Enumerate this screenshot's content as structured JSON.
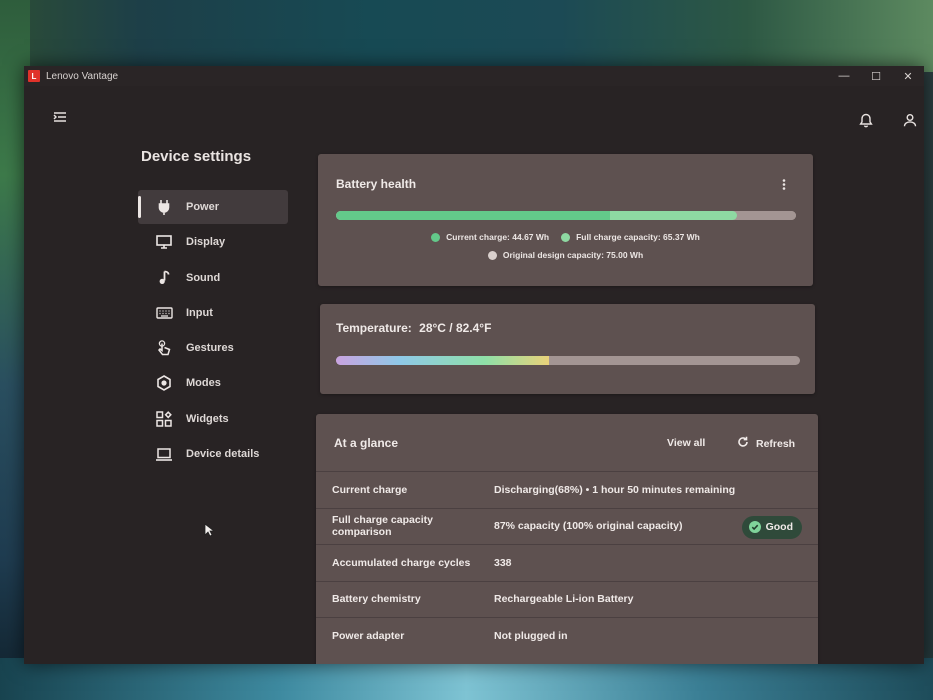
{
  "app": {
    "title": "Lenovo Vantage",
    "logo_letter": "L"
  },
  "window_controls": {
    "minimize": "—",
    "maximize": "☐",
    "close": "✕"
  },
  "page_title": "Device settings",
  "sidebar": {
    "items": [
      {
        "label": "Power",
        "icon": "power-plug-icon",
        "active": true
      },
      {
        "label": "Display",
        "icon": "monitor-icon",
        "active": false
      },
      {
        "label": "Sound",
        "icon": "music-note-icon",
        "active": false
      },
      {
        "label": "Input",
        "icon": "keyboard-icon",
        "active": false
      },
      {
        "label": "Gestures",
        "icon": "hand-gesture-icon",
        "active": false
      },
      {
        "label": "Modes",
        "icon": "hexagon-icon",
        "active": false
      },
      {
        "label": "Widgets",
        "icon": "widgets-icon",
        "active": false
      },
      {
        "label": "Device details",
        "icon": "laptop-icon",
        "active": false
      }
    ]
  },
  "battery_health": {
    "title": "Battery health",
    "current_charge_label": "Current charge: 44.67 Wh",
    "full_charge_label": "Full charge capacity: 65.37 Wh",
    "design_capacity_label": "Original design capacity: 75.00 Wh",
    "current_charge_wh": 44.67,
    "full_charge_wh": 65.37,
    "design_capacity_wh": 75.0,
    "colors": {
      "current": "#63c98a",
      "full": "#8ed9a2",
      "design": "#d9cfcc"
    }
  },
  "temperature": {
    "label": "Temperature:",
    "value": "28°C / 82.4°F",
    "fill_fraction": 0.46
  },
  "at_a_glance": {
    "title": "At a glance",
    "view_all": "View all",
    "refresh": "Refresh",
    "rows": [
      {
        "label": "Current charge",
        "value": "Discharging(68%)  •  1 hour 50 minutes remaining"
      },
      {
        "label": "Full charge capacity comparison",
        "value": "87% capacity (100% original capacity)",
        "badge": "Good"
      },
      {
        "label": "Accumulated charge cycles",
        "value": "338"
      },
      {
        "label": "Battery chemistry",
        "value": "Rechargeable Li-ion Battery"
      },
      {
        "label": "Power adapter",
        "value": "Not plugged in"
      }
    ]
  }
}
